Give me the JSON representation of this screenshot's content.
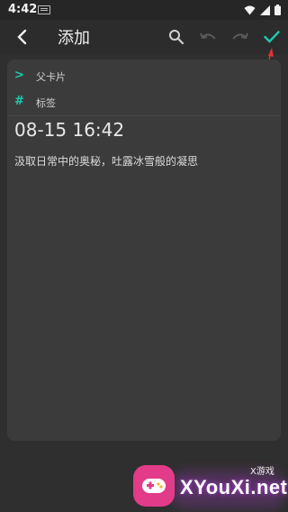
{
  "status_bar": {
    "time": "4:42"
  },
  "toolbar": {
    "title": "添加",
    "icons": [
      "back-arrow-icon",
      "search-icon",
      "undo-icon",
      "redo-icon",
      "check-icon"
    ]
  },
  "card": {
    "parent_card_label": "父卡片",
    "tags_label": "标签",
    "datetime": "08-15 16:42",
    "content": "汲取日常中的奥秘，吐露冰雪般的凝思"
  },
  "colors": {
    "accent": "#1ec9b0",
    "card_bg": "#3b3b3b",
    "page_bg": "#2f2f2f"
  },
  "watermark": {
    "tag": "X游戏",
    "name": "XYouXi.net"
  }
}
